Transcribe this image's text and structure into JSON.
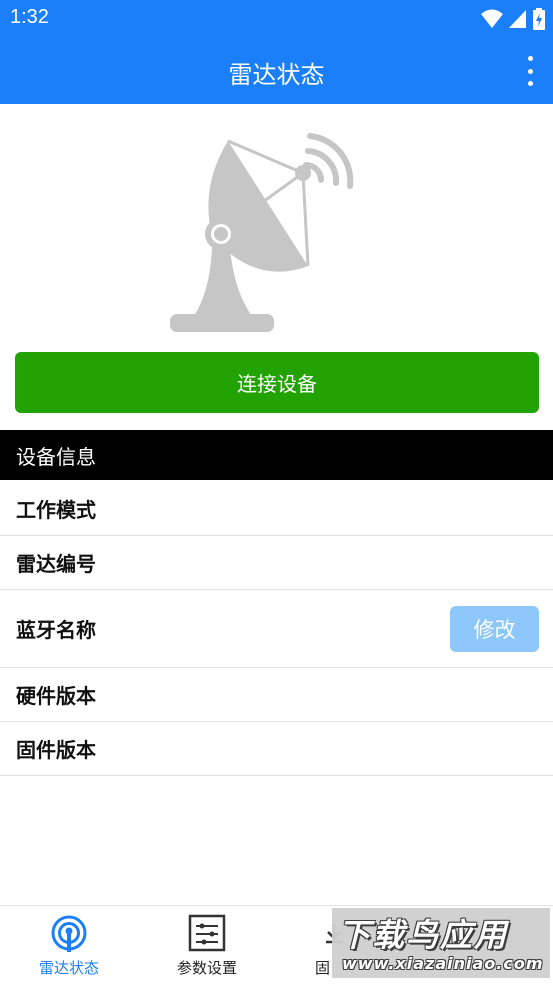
{
  "status_bar": {
    "time": "1:32",
    "icons": [
      "wifi-icon",
      "signal-icon",
      "battery-charging-icon"
    ]
  },
  "app_bar": {
    "title": "雷达状态",
    "menu_icon": "more-vert-icon"
  },
  "illustration": {
    "icon": "radar-dish-icon"
  },
  "connect_button": {
    "label": "连接设备",
    "color": "#22a303"
  },
  "device_info": {
    "header": "设备信息",
    "rows": [
      {
        "label": "工作模式"
      },
      {
        "label": "雷达编号"
      },
      {
        "label": "蓝牙名称",
        "action_label": "修改"
      },
      {
        "label": "硬件版本"
      },
      {
        "label": "固件版本"
      }
    ]
  },
  "bottom_nav": {
    "items": [
      {
        "label": "雷达状态",
        "icon": "radar-icon",
        "active": true
      },
      {
        "label": "参数设置",
        "icon": "sliders-icon",
        "active": false
      },
      {
        "label": "固",
        "icon": "firmware-icon",
        "active": false
      }
    ]
  },
  "watermark": {
    "title": "下载鸟应用",
    "url": "www.xiazainiao.com"
  },
  "colors": {
    "primary": "#1a7ff8",
    "success": "#22a303",
    "disabled_button": "#8ec7fa",
    "header_bg": "#000000"
  }
}
